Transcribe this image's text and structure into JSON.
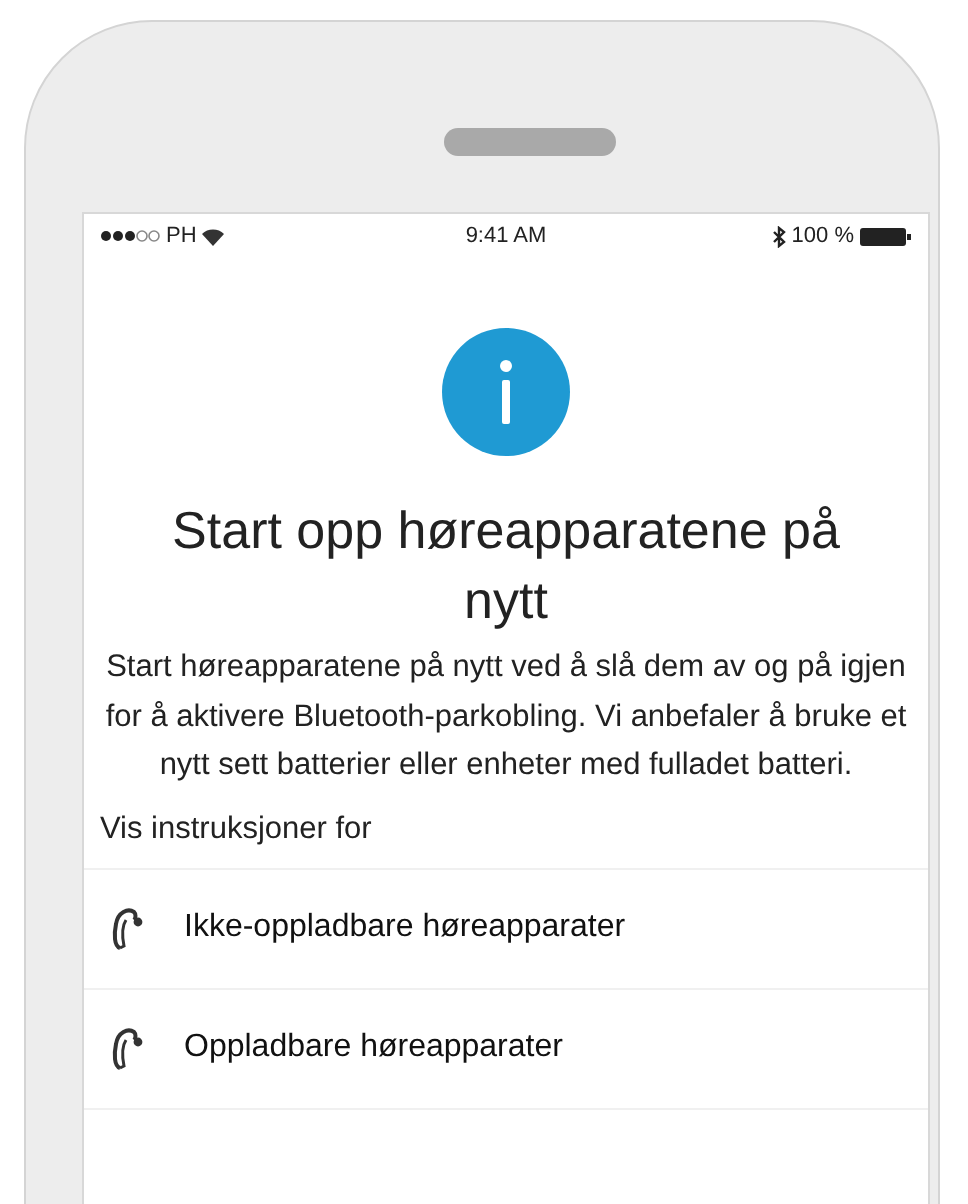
{
  "status_bar": {
    "carrier": "PH",
    "time": "9:41 AM",
    "battery": "100 %"
  },
  "dialog": {
    "title": "Start opp høreapparatene på nytt",
    "message": "Start høreapparatene på nytt ved å slå dem av og på igjen for å aktivere Bluetooth-parkobling. Vi anbefaler å bruke et nytt sett batterier eller enheter med fulladet batteri.",
    "section_label": "Vis instruksjoner for",
    "options": [
      {
        "label": "Ikke-oppladbare høreapparater"
      },
      {
        "label": "Oppladbare høreapparater"
      }
    ]
  }
}
